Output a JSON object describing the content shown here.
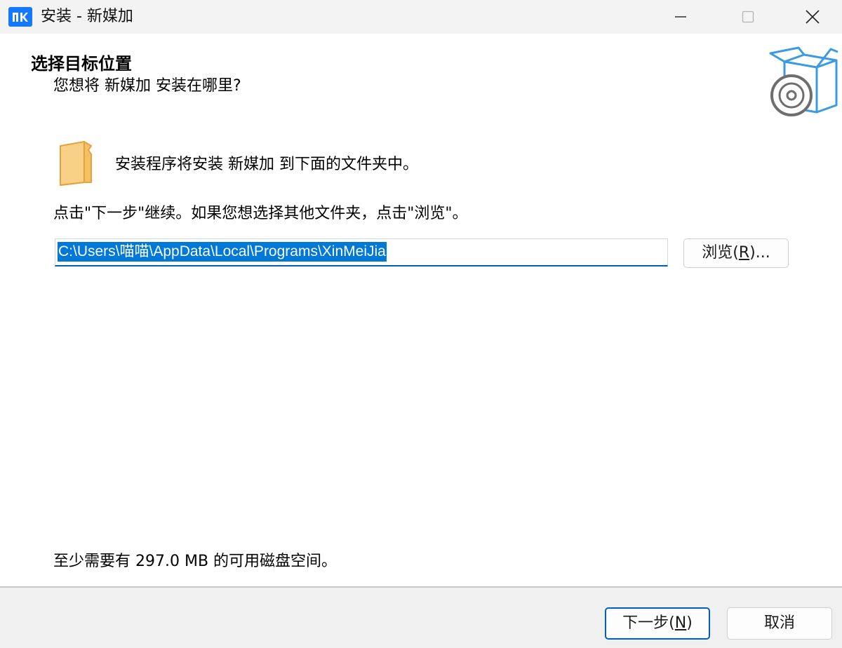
{
  "window": {
    "title": "安装 - 新媒加",
    "icon": "app-logo-icon",
    "accent": "#1677ff"
  },
  "header": {
    "title": "选择目标位置",
    "subtitle": "您想将 新媒加 安装在哪里?",
    "image": "box-with-disc-icon"
  },
  "body": {
    "install_to": "安装程序将安装 新媒加 到下面的文件夹中。",
    "instruction": "点击\"下一步\"继续。如果您想选择其他文件夹，点击\"浏览\"。",
    "path_value": "C:\\Users\\喵喵\\AppData\\Local\\Programs\\XinMeiJia",
    "browse_prefix": "浏览(",
    "browse_key": "R",
    "browse_suffix": ")...",
    "disk_space": "至少需要有 297.0 MB 的可用磁盘空间。"
  },
  "footer": {
    "next_prefix": "下一步(",
    "next_key": "N",
    "next_suffix": ")",
    "cancel_label": "取消"
  }
}
